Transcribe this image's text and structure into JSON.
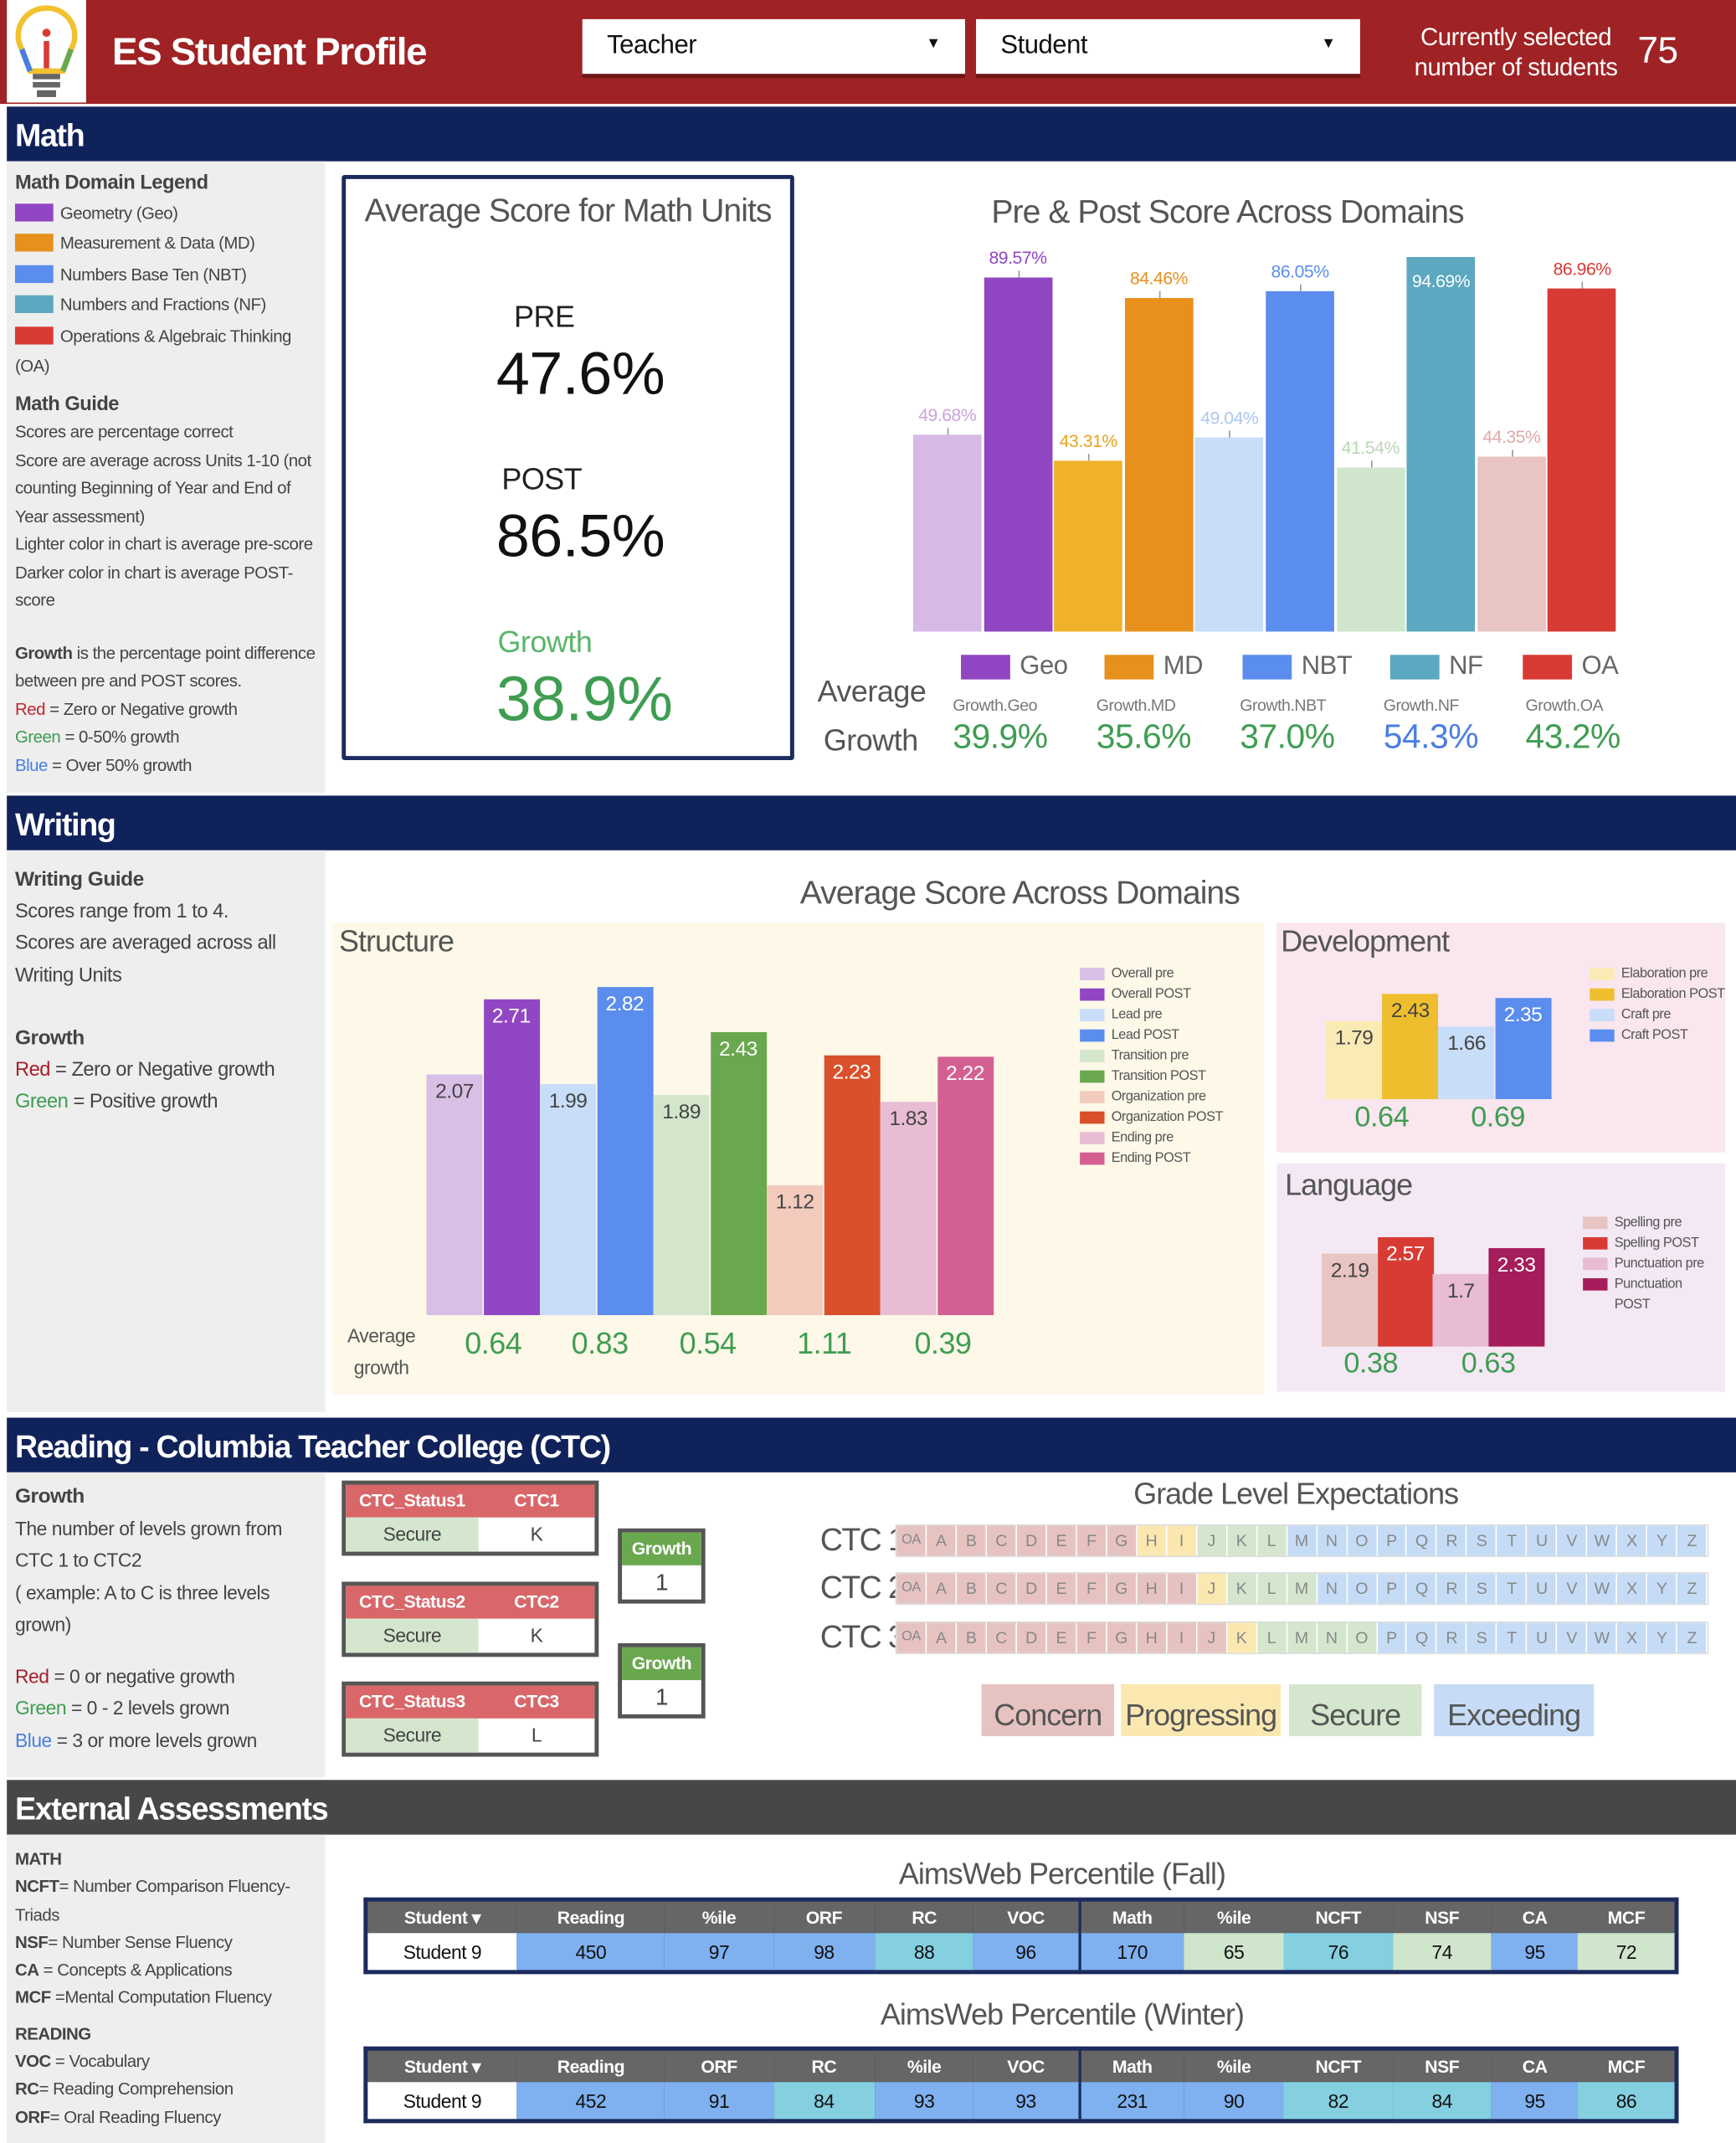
{
  "header": {
    "title": "ES Student Profile",
    "teacher_dropdown": "Teacher",
    "student_dropdown": "Student",
    "selected_label": "Currently selected number of students",
    "selected_count": "75"
  },
  "sections": {
    "math": "Math",
    "writing": "Writing",
    "reading": "Reading - Columbia Teacher College (CTC)",
    "external": "External Assessments"
  },
  "math_sidebar": {
    "legend_title": "Math Domain Legend",
    "legend": [
      {
        "label": "Geometry (Geo)",
        "color": "#9146c3"
      },
      {
        "label": "Measurement & Data (MD)",
        "color": "#e8901c"
      },
      {
        "label": "Numbers Base Ten (NBT)",
        "color": "#5b8def"
      },
      {
        "label": "Numbers and Fractions (NF)",
        "color": "#5ba8c0"
      },
      {
        "label": "Operations & Algebraic Thinking (OA)",
        "color": "#d83b33"
      }
    ],
    "guide_title": "Math Guide",
    "guide": [
      "Scores are percentage correct",
      "Score are average across Units 1-10 (not counting Beginning of Year and End of Year assessment)",
      "Lighter color in chart is average pre-score",
      "Darker color in chart is average POST-score"
    ],
    "growth_key": "Growth",
    "growth_text": " is the percentage point difference between pre and POST scores.",
    "red_key": "Red",
    "red_text": " = Zero or Negative growth",
    "green_key": "Green",
    "green_text": " = 0-50% growth",
    "blue_key": "Blue",
    "blue_text": " = Over 50% growth"
  },
  "math_card": {
    "title": "Average Score for Math Units",
    "pre_label": "PRE",
    "pre_value": "47.6%",
    "post_label": "POST",
    "post_value": "86.5%",
    "growth_label": "Growth",
    "growth_value": "38.9%"
  },
  "chart_data": [
    {
      "type": "bar",
      "title": "Pre & Post Score Across Domains",
      "ylim": [
        0,
        100
      ],
      "categories": [
        "Geo",
        "MD",
        "NBT",
        "NF",
        "OA"
      ],
      "series": [
        {
          "name": "pre",
          "values": [
            49.68,
            43.31,
            49.04,
            41.54,
            44.35
          ],
          "labels": [
            "49.68%",
            "43.31%",
            "49.04%",
            "41.54%",
            "44.35%"
          ],
          "colors": [
            "#d6b9e5",
            "#f0b22b",
            "#c7ddf8",
            "#cfe5cc",
            "#e8c4c2"
          ],
          "label_colors": [
            "#c9a4dc",
            "#e9a21c",
            "#a9c8f0",
            "#b9d8b4",
            "#e0aaa6"
          ]
        },
        {
          "name": "post",
          "values": [
            89.57,
            84.46,
            86.05,
            94.69,
            86.96
          ],
          "labels": [
            "89.57%",
            "84.46%",
            "86.05%",
            "94.69%",
            "86.96%"
          ],
          "colors": [
            "#9146c3",
            "#e8901c",
            "#5b8def",
            "#5ba8c0",
            "#d83b33"
          ],
          "label_colors": [
            "#9146c3",
            "#e8901c",
            "#5b8def",
            "#ffffff",
            "#d83b33"
          ]
        }
      ],
      "legend": [
        {
          "label": "Geo",
          "color": "#9146c3"
        },
        {
          "label": "MD",
          "color": "#e8901c"
        },
        {
          "label": "NBT",
          "color": "#5b8def"
        },
        {
          "label": "NF",
          "color": "#5ba8c0"
        },
        {
          "label": "OA",
          "color": "#d83b33"
        }
      ],
      "growth_title": "Average Growth",
      "growth": [
        {
          "label": "Growth.Geo",
          "value": "39.9%",
          "color": "#3f9d52"
        },
        {
          "label": "Growth.MD",
          "value": "35.6%",
          "color": "#3f9d52"
        },
        {
          "label": "Growth.NBT",
          "value": "37.0%",
          "color": "#3f9d52"
        },
        {
          "label": "Growth.NF",
          "value": "54.3%",
          "color": "#4a7fe0"
        },
        {
          "label": "Growth.OA",
          "value": "43.2%",
          "color": "#3f9d52"
        }
      ]
    },
    {
      "type": "bar",
      "title": "Structure",
      "ylim": [
        0,
        4
      ],
      "bars": [
        {
          "name": "Overall pre",
          "value": 2.07,
          "color": "#d8bfe6",
          "label_color": "#444"
        },
        {
          "name": "Overall POST",
          "value": 2.71,
          "color": "#9146c3",
          "label_color": "#fff"
        },
        {
          "name": "Lead pre",
          "value": 1.99,
          "color": "#c7ddf8",
          "label_color": "#444"
        },
        {
          "name": "Lead POST",
          "value": 2.82,
          "color": "#5b8def",
          "label_color": "#fff"
        },
        {
          "name": "Transition pre",
          "value": 1.89,
          "color": "#d3e6cc",
          "label_color": "#444"
        },
        {
          "name": "Transition POST",
          "value": 2.43,
          "color": "#6aa84f",
          "label_color": "#fff"
        },
        {
          "name": "Organization pre",
          "value": 1.12,
          "color": "#f2cbbd",
          "label_color": "#444"
        },
        {
          "name": "Organization POST",
          "value": 2.23,
          "color": "#d9502a",
          "label_color": "#fff"
        },
        {
          "name": "Ending pre",
          "value": 1.83,
          "color": "#e8bcd3",
          "label_color": "#444"
        },
        {
          "name": "Ending POST",
          "value": 2.22,
          "color": "#d45f92",
          "label_color": "#fff"
        }
      ],
      "growth_title": "Average growth",
      "growth": [
        "0.64",
        "0.83",
        "0.54",
        "1.11",
        "0.39"
      ]
    },
    {
      "type": "bar",
      "title": "Development",
      "ylim": [
        0,
        4
      ],
      "bars": [
        {
          "name": "Elaboration pre",
          "value": 1.79,
          "color": "#faeab4",
          "label_color": "#444"
        },
        {
          "name": "Elaboration POST",
          "value": 2.43,
          "color": "#efbe2f",
          "label_color": "#444"
        },
        {
          "name": "Craft pre",
          "value": 1.66,
          "color": "#c7ddf8",
          "label_color": "#444"
        },
        {
          "name": "Craft POST",
          "value": 2.35,
          "color": "#5b8def",
          "label_color": "#fff"
        }
      ],
      "growth": [
        "0.64",
        "0.69"
      ]
    },
    {
      "type": "bar",
      "title": "Language",
      "ylim": [
        0,
        4
      ],
      "bars": [
        {
          "name": "Spelling pre",
          "value": 2.19,
          "color": "#e8c4c2",
          "label_color": "#444"
        },
        {
          "name": "Spelling POST",
          "value": 2.57,
          "color": "#d83b33",
          "label_color": "#fff"
        },
        {
          "name": "Punctuation pre",
          "value": 1.7,
          "color": "#e8bcd3",
          "label_color": "#444"
        },
        {
          "name": "Punctuation POST",
          "value": 2.33,
          "color": "#a51d5a",
          "label_color": "#fff"
        }
      ],
      "growth": [
        "0.38",
        "0.63"
      ]
    }
  ],
  "writing": {
    "title": "Average Score Across Domains"
  },
  "writing_sidebar": {
    "guide_title": "Writing Guide",
    "guide": [
      "Scores range from  1 to 4.",
      "Scores are averaged across all Writing Units"
    ],
    "growth_title": "Growth",
    "red_key": "Red",
    "red_text": " = Zero or Negative growth",
    "green_key": "Green",
    "green_text": " = Positive growth"
  },
  "reading_sidebar": {
    "growth_title": "Growth",
    "text": "The number of levels grown from CTC 1 to CTC2",
    "example": "( example: A to C is three levels grown)",
    "red_key": "Red",
    "red_text": " = 0 or negative growth",
    "green_key": "Green",
    "green_text": " = 0 - 2 levels grown",
    "blue_key": "Blue",
    "blue_text": " = 3 or more levels grown"
  },
  "ctc": {
    "boxes": [
      {
        "status_header": "CTC_Status1",
        "level_header": "CTC1",
        "status": "Secure",
        "level": "K"
      },
      {
        "status_header": "CTC_Status2",
        "level_header": "CTC2",
        "status": "Secure",
        "level": "K"
      },
      {
        "status_header": "CTC_Status3",
        "level_header": "CTC3",
        "status": "Secure",
        "level": "L"
      }
    ],
    "growth": [
      {
        "label": "Growth",
        "value": "1"
      },
      {
        "label": "Growth",
        "value": "1"
      }
    ],
    "gle_title": "Grade Level Expectations",
    "levels": [
      "OA",
      "A",
      "B",
      "C",
      "D",
      "E",
      "F",
      "G",
      "H",
      "I",
      "J",
      "K",
      "L",
      "M",
      "N",
      "O",
      "P",
      "Q",
      "R",
      "S",
      "T",
      "U",
      "V",
      "W",
      "X",
      "Y",
      "Z"
    ],
    "rows": [
      {
        "label": "CTC 1",
        "concern_through": "G",
        "progressing_through": "I",
        "secure_through": "L"
      },
      {
        "label": "CTC 2",
        "concern_through": "I",
        "progressing_through": "J",
        "secure_through": "M"
      },
      {
        "label": "CTC 3",
        "concern_through": "J",
        "progressing_through": "K",
        "secure_through": "O"
      }
    ],
    "key": [
      {
        "label": "Concern",
        "color": "#e6c3c1"
      },
      {
        "label": "Progressing",
        "color": "#fbe8b0"
      },
      {
        "label": "Secure",
        "color": "#d4e6cd"
      },
      {
        "label": "Exceeding",
        "color": "#c6dcf6"
      }
    ]
  },
  "external_sidebar": {
    "math_title": "MATH",
    "math_items": [
      {
        "k": "NCFT",
        "v": "= Number Comparison Fluency-Triads"
      },
      {
        "k": "NSF",
        "v": "= Number Sense Fluency"
      },
      {
        "k": "CA",
        "v": " = Concepts & Applications"
      },
      {
        "k": "MCF",
        "v": " =Mental Computation Fluency"
      }
    ],
    "reading_title": "READING",
    "reading_items": [
      {
        "k": "VOC",
        "v": " = Vocabulary"
      },
      {
        "k": "RC",
        "v": "= Reading Comprehension"
      },
      {
        "k": "ORF",
        "v": "= Oral Reading Fluency"
      }
    ]
  },
  "aims": [
    {
      "title": "AimsWeb Percentile (Fall)",
      "headers": [
        "Student ▾",
        "Reading",
        "%ile",
        "ORF",
        "RC",
        "VOC",
        "Math",
        "%ile",
        "NCFT",
        "NSF",
        "CA",
        "MCF"
      ],
      "row": [
        "Student 9",
        "450",
        "97",
        "98",
        "88",
        "96",
        "170",
        "65",
        "76",
        "74",
        "95",
        "72"
      ],
      "colors": [
        "#ffffff",
        "#7fb0ef",
        "#7fb0ef",
        "#7fb0ef",
        "#84cfe0",
        "#7fb0ef",
        "#7fb0ef",
        "#cfe5cc",
        "#84cfe0",
        "#cfe5cc",
        "#7fb0ef",
        "#cfe5cc"
      ]
    },
    {
      "title": "AimsWeb Percentile (Winter)",
      "headers": [
        "Student ▾",
        "Reading",
        "ORF",
        "RC",
        "%ile",
        "VOC",
        "Math",
        "%ile",
        "NCFT",
        "NSF",
        "CA",
        "MCF"
      ],
      "row": [
        "Student 9",
        "452",
        "91",
        "84",
        "93",
        "93",
        "231",
        "90",
        "82",
        "84",
        "95",
        "86"
      ],
      "colors": [
        "#ffffff",
        "#7fb0ef",
        "#7fb0ef",
        "#84cfe0",
        "#7fb0ef",
        "#7fb0ef",
        "#7fb0ef",
        "#7fb0ef",
        "#84cfe0",
        "#84cfe0",
        "#7fb0ef",
        "#84cfe0"
      ]
    }
  ]
}
